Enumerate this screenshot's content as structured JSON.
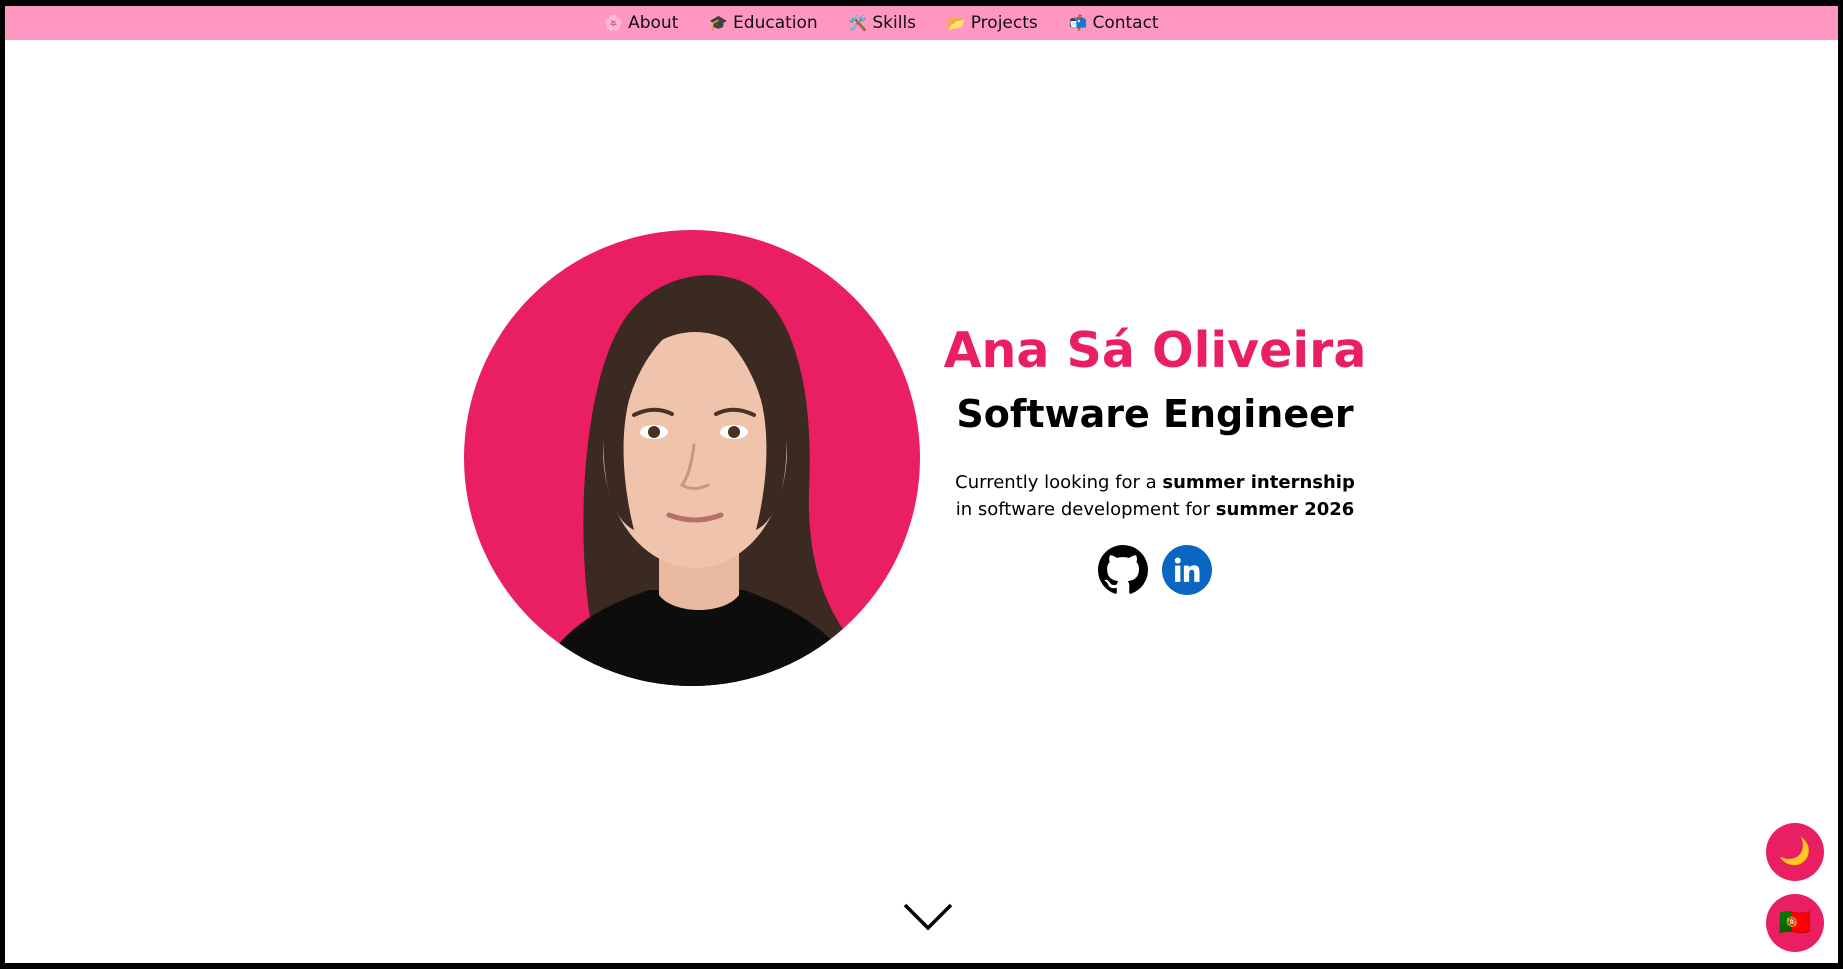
{
  "nav": {
    "items": [
      {
        "icon": "🌸",
        "icon_name": "flower-icon",
        "label": "About"
      },
      {
        "icon": "🎓",
        "icon_name": "graduation-cap-icon",
        "label": "Education"
      },
      {
        "icon": "🛠️",
        "icon_name": "tools-icon",
        "label": "Skills"
      },
      {
        "icon": "📂",
        "icon_name": "folder-icon",
        "label": "Projects"
      },
      {
        "icon": "📬",
        "icon_name": "mailbox-icon",
        "label": "Contact"
      }
    ]
  },
  "hero": {
    "name": "Ana Sá Oliveira",
    "role": "Software Engineer",
    "tagline_part1": "Currently looking for a ",
    "tagline_bold1": "summer internship",
    "tagline_part2": "in software development for ",
    "tagline_bold2": "summer 2026"
  },
  "socials": [
    {
      "name": "github-icon"
    },
    {
      "name": "linkedin-icon"
    }
  ],
  "buttons": {
    "theme_icon": "🌙",
    "language_icon": "🇵🇹"
  },
  "colors": {
    "accent": "#e91e63",
    "navbar": "#ff97c1",
    "linkedin": "#0a66c2"
  }
}
